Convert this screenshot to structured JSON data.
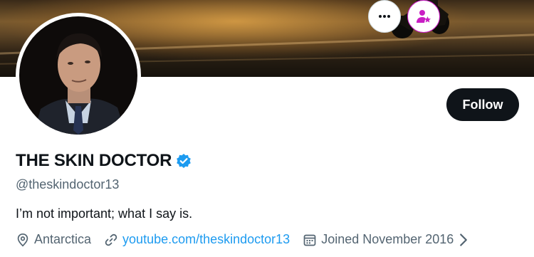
{
  "profile": {
    "display_name": "THE SKIN DOCTOR",
    "handle": "@theskindoctor13",
    "bio": "I’m not important; what I say is.",
    "location": "Antarctica",
    "website": "youtube.com/theskindoctor13",
    "joined": "Joined November 2016"
  },
  "actions": {
    "follow_label": "Follow",
    "more_icon": "more-icon",
    "subscribe_icon": "subscribe-person-star-icon"
  },
  "colors": {
    "accent_link": "#1d9bf0",
    "follow_bg": "#0f1419",
    "subscribe_accent": "#c91ec4",
    "muted_text": "#536471",
    "verified_badge": "#1d9bf0"
  }
}
